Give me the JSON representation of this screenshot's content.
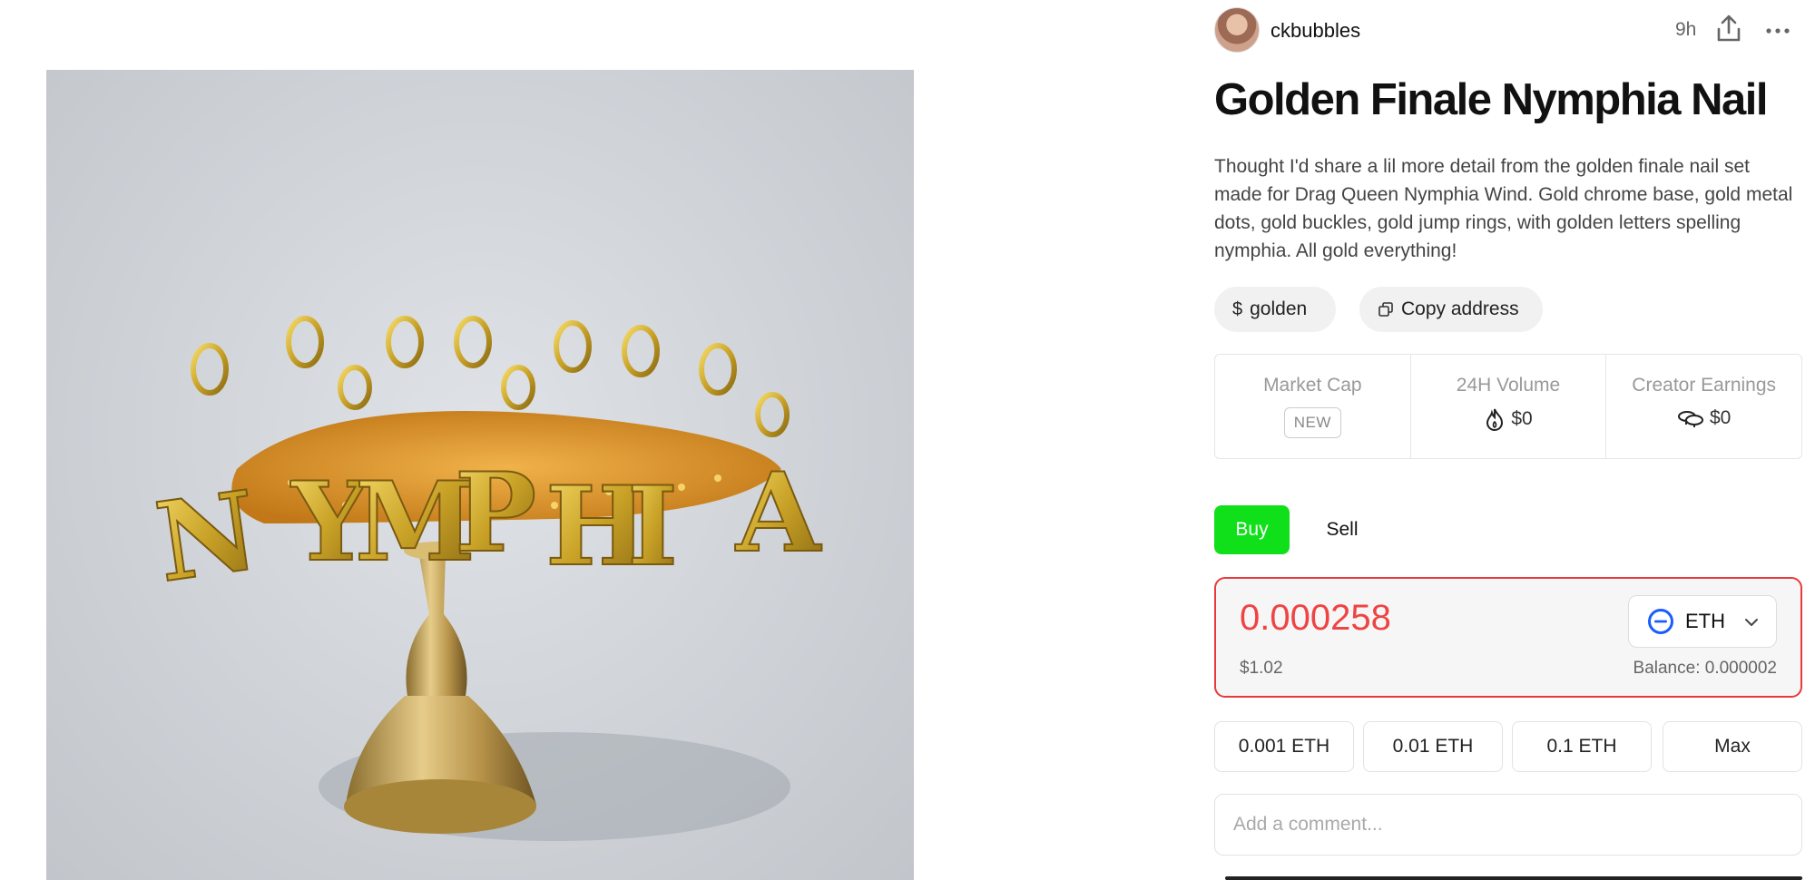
{
  "post": {
    "image_alt": "Golden nail charm with letters spelling NYMPHIA on a gold stand",
    "image_letters": "NYMPHIA"
  },
  "header": {
    "username": "ckbubbles",
    "time": "9h",
    "share_icon": "share-icon",
    "more_icon": "more-icon"
  },
  "title": "Golden Finale Nymphia Nail",
  "description": "Thought I'd share a lil more detail from the golden finale nail set made for Drag Queen Nymphia Wind. Gold chrome base, gold metal dots, gold buckles, gold jump rings, with golden letters spelling nymphia. All gold everything!",
  "pills": {
    "ticker_glyph": "$",
    "ticker": "golden",
    "copy_label": "Copy address"
  },
  "stats": {
    "market_cap_label": "Market Cap",
    "market_cap_value": "NEW",
    "volume_label": "24H Volume",
    "volume_value": "$0",
    "earnings_label": "Creator Earnings",
    "earnings_value": "$0"
  },
  "trade": {
    "buy_label": "Buy",
    "sell_label": "Sell",
    "amount": "0.000258",
    "usd_value": "$1.02",
    "balance": "Balance: 0.000002",
    "currency": "ETH",
    "quick_amounts": [
      "0.001 ETH",
      "0.01 ETH",
      "0.1 ETH",
      "Max"
    ]
  },
  "comment": {
    "placeholder": "Add a comment..."
  },
  "colors": {
    "buy": "#10e01a",
    "error_border": "#e83a3a",
    "amount_text": "#ef4444",
    "eth_blue": "#1a5cff"
  }
}
